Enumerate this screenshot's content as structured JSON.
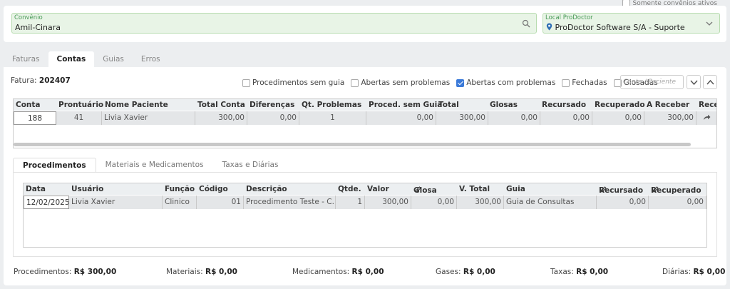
{
  "only_active_label": "Somente convênios ativos",
  "convenio": {
    "label": "Convênio",
    "value": "Amil-Cinara"
  },
  "local": {
    "label": "Local ProDoctor",
    "value": "ProDoctor Software S/A - Suporte"
  },
  "tabs": [
    "Faturas",
    "Contas",
    "Guias",
    "Erros"
  ],
  "fatura": {
    "label": "Fatura:",
    "value": "202407"
  },
  "filters": [
    {
      "label": "Procedimentos sem guia",
      "checked": false
    },
    {
      "label": "Abertas sem problemas",
      "checked": false
    },
    {
      "label": "Abertas com problemas",
      "checked": true
    },
    {
      "label": "Fechadas",
      "checked": false
    },
    {
      "label": "Glosadas",
      "checked": false
    }
  ],
  "search_placeholder": "Conta / Paciente",
  "contas_table": {
    "headers": [
      "Conta",
      "Prontuário",
      "Nome Paciente",
      "Total Conta",
      "Diferenças",
      "Qt. Problemas",
      "Proced. sem Guia",
      "Total",
      "Glosas",
      "Recursado",
      "Recuperado",
      "A Receber",
      "Rece"
    ],
    "row": [
      "188",
      "41",
      "Livia Xavier",
      "300,00",
      "0,00",
      "1",
      "0,00",
      "300,00",
      "0,00",
      "0,00",
      "0,00",
      "300,00"
    ]
  },
  "sub_tabs": [
    "Procedimentos",
    "Materiais e Medicamentos",
    "Taxas e Diárias"
  ],
  "proc_table": {
    "headers": [
      "Data",
      "Usuário",
      "Função",
      "Código",
      "Descrição",
      "Qtde.",
      "Valor",
      "Glosa",
      "V. Total",
      "Guia",
      "Recursado",
      "Recuperado"
    ],
    "row": [
      "12/02/2025",
      "Livia Xavier",
      "Clinico",
      "01",
      "Procedimento Teste - C...",
      "1",
      "300,00",
      "0,00",
      "300,00",
      "Guia de Consultas",
      "0,00",
      "0,00"
    ]
  },
  "totals": [
    {
      "label": "Procedimentos:",
      "value": "R$ 300,00"
    },
    {
      "label": "Materiais:",
      "value": "R$ 0,00"
    },
    {
      "label": "Medicamentos:",
      "value": "R$ 0,00"
    },
    {
      "label": "Gases:",
      "value": "R$ 0,00"
    },
    {
      "label": "Taxas:",
      "value": "R$ 0,00"
    },
    {
      "label": "Diárias:",
      "value": "R$ 0,00"
    }
  ],
  "colors": {
    "accent": "#3b7ad9",
    "field_bg": "#e8f4e6",
    "field_label": "#4a9a58"
  }
}
